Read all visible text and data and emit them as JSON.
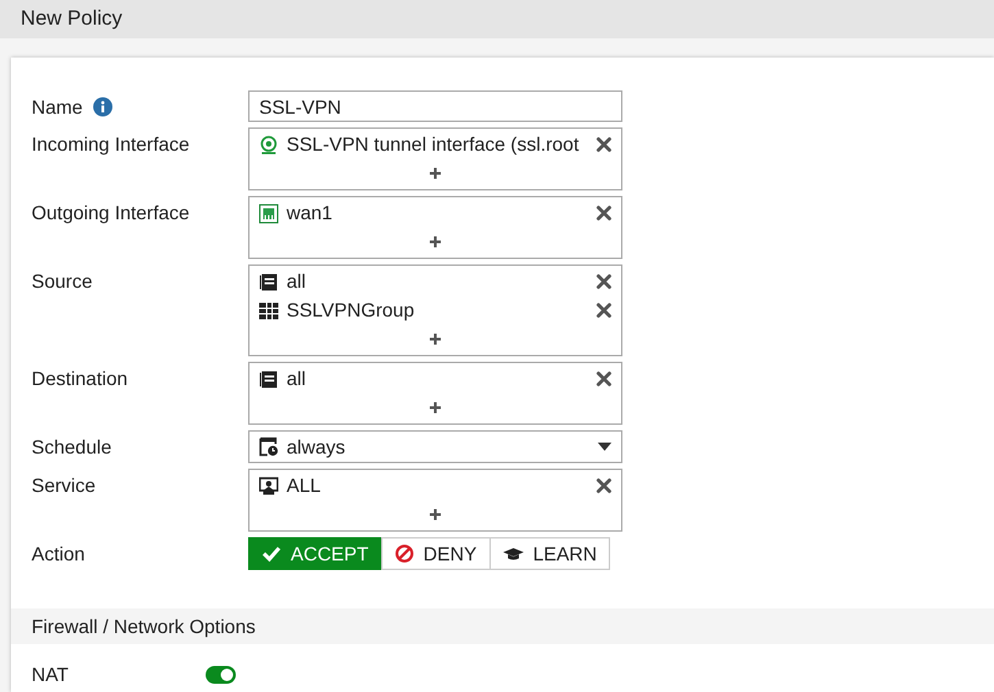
{
  "window": {
    "title": "New Policy"
  },
  "fields": [
    {
      "label": "Name",
      "kind": "text",
      "info": true,
      "value": "SSL-VPN"
    },
    {
      "label": "Incoming Interface",
      "kind": "list",
      "entries": [
        {
          "kind": "tunnel",
          "text": "SSL-VPN tunnel interface (ssl.root"
        }
      ]
    },
    {
      "label": "Outgoing Interface",
      "kind": "list",
      "entries": [
        {
          "kind": "port",
          "text": "wan1"
        }
      ]
    },
    {
      "label": "Source",
      "kind": "list",
      "entries": [
        {
          "kind": "address",
          "text": "all"
        },
        {
          "kind": "group",
          "text": "SSLVPNGroup"
        }
      ]
    },
    {
      "label": "Destination",
      "kind": "list",
      "entries": [
        {
          "kind": "address",
          "text": "all"
        }
      ]
    },
    {
      "label": "Schedule",
      "kind": "select",
      "value": "always"
    },
    {
      "label": "Service",
      "kind": "list",
      "entries": [
        {
          "kind": "service",
          "text": "ALL"
        }
      ]
    },
    {
      "label": "Action",
      "kind": "actions",
      "options": [
        {
          "kind": "accept",
          "label": "ACCEPT",
          "selected": true
        },
        {
          "kind": "deny",
          "label": "DENY",
          "selected": false
        },
        {
          "kind": "learn",
          "label": "LEARN",
          "selected": false
        }
      ]
    }
  ],
  "section": {
    "title": "Firewall / Network Options",
    "toggles": [
      {
        "label": "NAT",
        "on": true
      }
    ]
  }
}
